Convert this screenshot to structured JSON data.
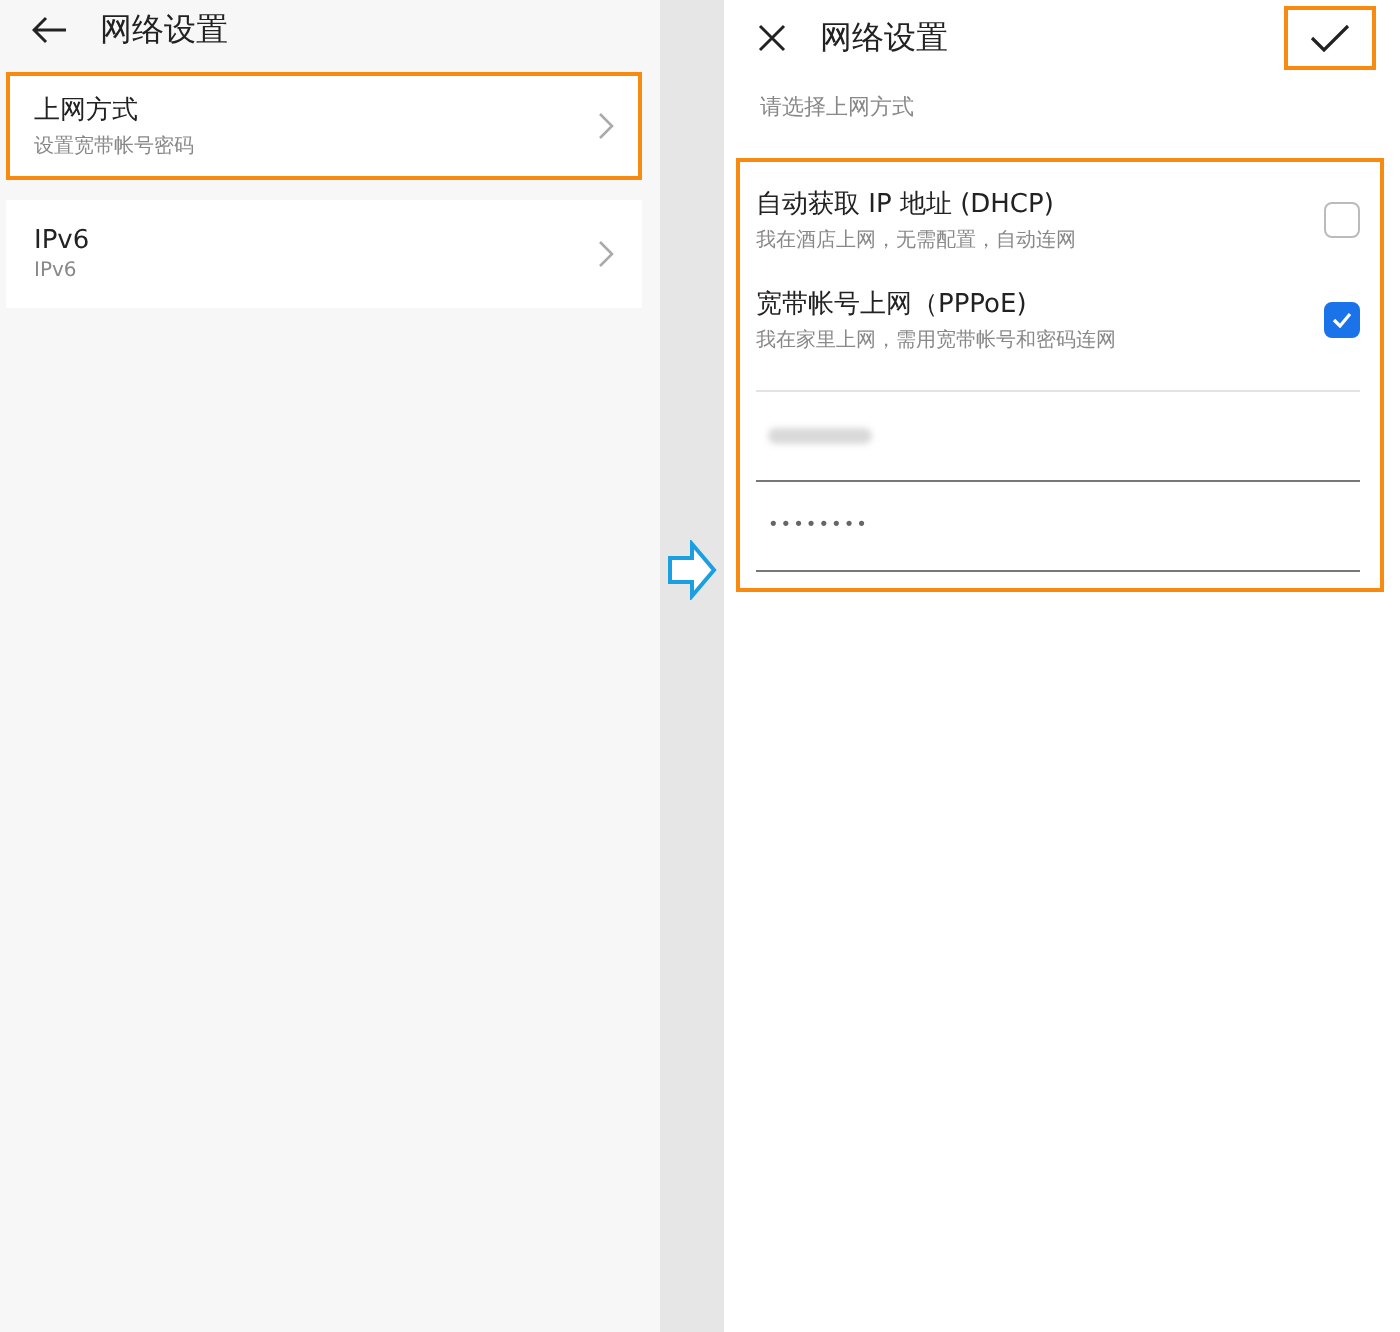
{
  "left_screen": {
    "title": "网络设置",
    "items": [
      {
        "title": "上网方式",
        "subtitle": "设置宽带帐号密码",
        "highlighted": true
      },
      {
        "title": "IPv6",
        "subtitle": "IPv6",
        "highlighted": false
      }
    ]
  },
  "right_screen": {
    "title": "网络设置",
    "confirm_highlighted": true,
    "hint": "请选择上网方式",
    "options_highlighted": true,
    "options": [
      {
        "title": "自动获取 IP 地址 (DHCP)",
        "subtitle": "我在酒店上网，无需配置，自动连网",
        "checked": false
      },
      {
        "title": "宽带帐号上网（PPPoE)",
        "subtitle": "我在家里上网，需用宽带帐号和密码连网",
        "checked": true
      }
    ],
    "password": {
      "value": "••••••••"
    }
  }
}
